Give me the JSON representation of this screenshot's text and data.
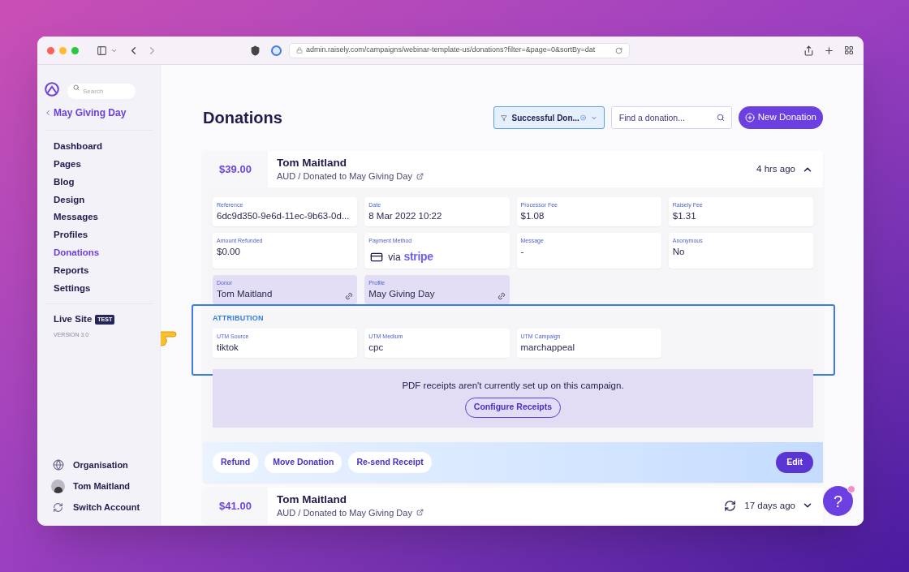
{
  "browser": {
    "url": "admin.raisely.com/campaigns/webinar-template-us/donations?filter=&page=0&sortBy=dat"
  },
  "sidebar": {
    "search_placeholder": "Search",
    "campaign": "May Giving Day",
    "nav": [
      {
        "label": "Dashboard",
        "selected": false
      },
      {
        "label": "Pages",
        "selected": false
      },
      {
        "label": "Blog",
        "selected": false
      },
      {
        "label": "Design",
        "selected": false
      },
      {
        "label": "Messages",
        "selected": false
      },
      {
        "label": "Profiles",
        "selected": false
      },
      {
        "label": "Donations",
        "selected": true
      },
      {
        "label": "Reports",
        "selected": false
      },
      {
        "label": "Settings",
        "selected": false
      }
    ],
    "live_site": {
      "label": "Live Site",
      "badge": "TEST"
    },
    "version": "VERSION 3.0",
    "footer": [
      {
        "kind": "globe",
        "label": "Organisation"
      },
      {
        "kind": "avatar",
        "label": "Tom Maitland"
      },
      {
        "kind": "switch",
        "label": "Switch Account"
      }
    ]
  },
  "header": {
    "title": "Donations",
    "filter": "Successful Don...",
    "search_placeholder": "Find a donation...",
    "new_button": "New Donation"
  },
  "donations": [
    {
      "amount": "$39.00",
      "name": "Tom Maitland",
      "subtitle": "AUD / Donated to May Giving Day",
      "time": "4 hrs ago",
      "expanded": true,
      "recurring": false,
      "fields": [
        {
          "kind": "text",
          "label": "Reference",
          "value": "6dc9d350-9e6d-11ec-9b63-0d..."
        },
        {
          "kind": "text",
          "label": "Date",
          "value": "8 Mar 2022 10:22"
        },
        {
          "kind": "text",
          "label": "Processor Fee",
          "value": "$1.08"
        },
        {
          "kind": "text",
          "label": "Raisely Fee",
          "value": "$1.31"
        },
        {
          "kind": "text",
          "label": "Amount Refunded",
          "value": "$0.00"
        },
        {
          "kind": "payment",
          "label": "Payment Method",
          "value": "via",
          "brand": "stripe"
        },
        {
          "kind": "text",
          "label": "Message",
          "value": "-"
        },
        {
          "kind": "text",
          "label": "Anonymous",
          "value": "No"
        },
        {
          "kind": "link",
          "label": "Donor",
          "value": "Tom Maitland"
        },
        {
          "kind": "link",
          "label": "Profile",
          "value": "May Giving Day"
        }
      ],
      "attribution": {
        "heading": "ATTRIBUTION",
        "fields": [
          {
            "label": "UTM Source",
            "value": "tiktok"
          },
          {
            "label": "UTM Medium",
            "value": "cpc"
          },
          {
            "label": "UTM Campaign",
            "value": "marchappeal"
          }
        ]
      },
      "receipts": {
        "message": "PDF receipts aren't currently set up on this campaign.",
        "button": "Configure Receipts"
      },
      "actions": [
        "Refund",
        "Move Donation",
        "Re-send Receipt"
      ],
      "edit_button": "Edit"
    },
    {
      "amount": "$41.00",
      "name": "Tom Maitland",
      "subtitle": "AUD / Donated to May Giving Day",
      "time": "17 days ago",
      "expanded": false,
      "recurring": true
    }
  ],
  "help_button": "?"
}
